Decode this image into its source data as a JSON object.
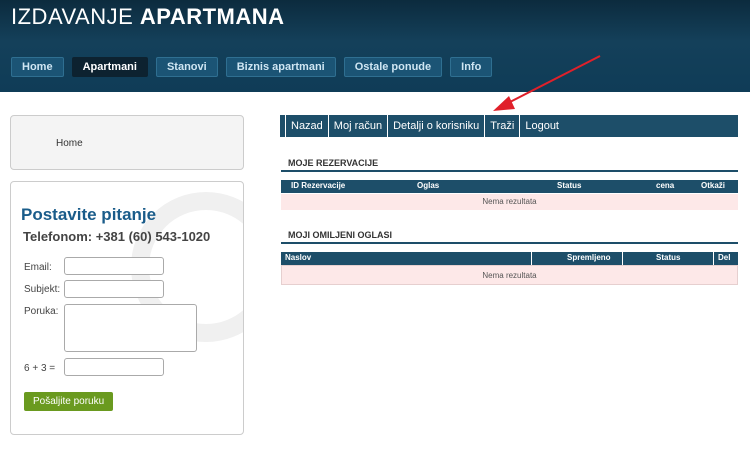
{
  "header": {
    "brand_light": "IZDAVANJE",
    "brand_bold": "APARTMANA",
    "nav": [
      "Home",
      "Apartmani",
      "Stanovi",
      "Biznis apartmani",
      "Ostale ponude",
      "Info"
    ],
    "active_nav": "Apartmani"
  },
  "sidebar": {
    "home_link": "Home",
    "contact": {
      "title": "Postavite pitanje",
      "phone": "Telefonom: +381 (60) 543-1020",
      "email_label": "Email:",
      "subject_label": "Subjekt:",
      "message_label": "Poruka:",
      "captcha_label": "6 + 3 =",
      "submit_label": "Pošaljite poruku"
    }
  },
  "toolbar": [
    "Nazad",
    "Moj račun",
    "Detalji o korisniku",
    "Traži",
    "Logout"
  ],
  "reservations": {
    "title": "MOJE REZERVACIJE",
    "columns": [
      "ID Rezervacije",
      "Oglas",
      "Status",
      "cena",
      "Otkaži"
    ],
    "empty_text": "Nema rezultata"
  },
  "favorites": {
    "title": "MOJI OMILJENI OGLASI",
    "columns": [
      "Naslov",
      "Spremljeno",
      "Status",
      "Del"
    ],
    "empty_text": "Nema rezultata"
  },
  "colors": {
    "accent": "#1d4e69",
    "annotation_arrow": "#e0202a",
    "empty_row_bg": "#fde8e8"
  }
}
